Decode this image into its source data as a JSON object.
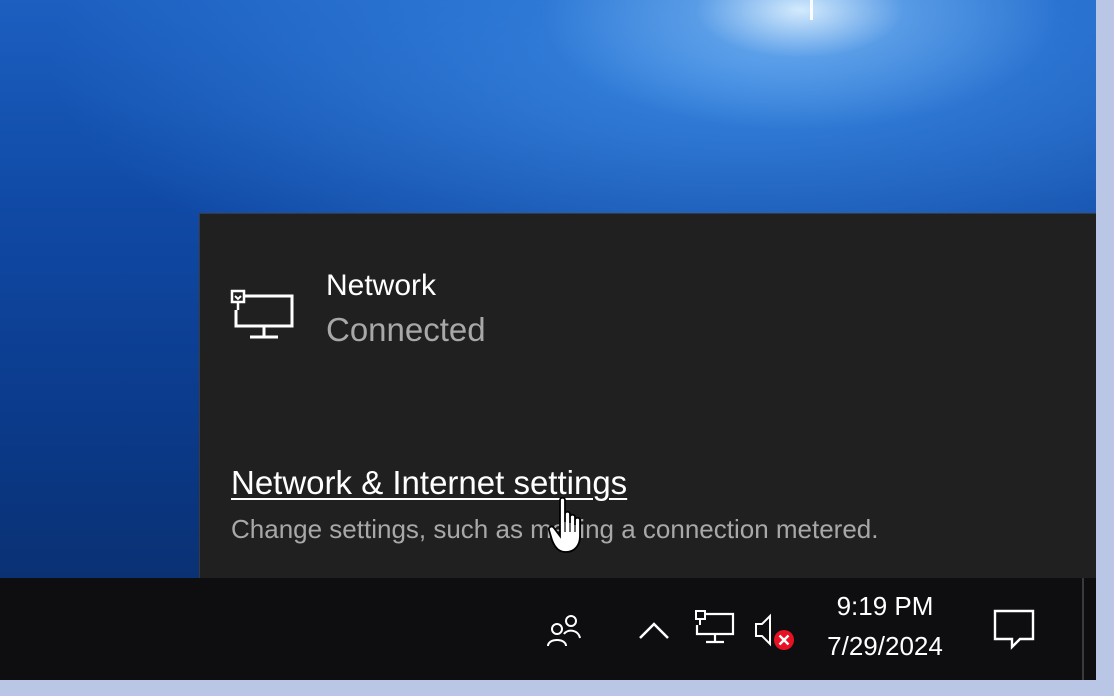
{
  "flyout": {
    "network_name": "Network",
    "network_status": "Connected",
    "settings_link": "Network & Internet settings",
    "settings_description": "Change settings, such as making a connection metered.",
    "network_icon": "ethernet-monitor-icon"
  },
  "taskbar": {
    "people_icon": "people-icon",
    "chevron_icon": "chevron-up-icon",
    "network_icon": "network-monitor-icon",
    "volume_icon": "volume-muted-icon",
    "clock_time": "9:19 PM",
    "clock_date": "7/29/2024",
    "action_center_icon": "action-center-icon"
  },
  "colors": {
    "flyout_bg": "#202020",
    "taskbar_bg": "#0e0e10",
    "muted_red": "#e81123",
    "secondary_text": "#a8a8a8"
  }
}
